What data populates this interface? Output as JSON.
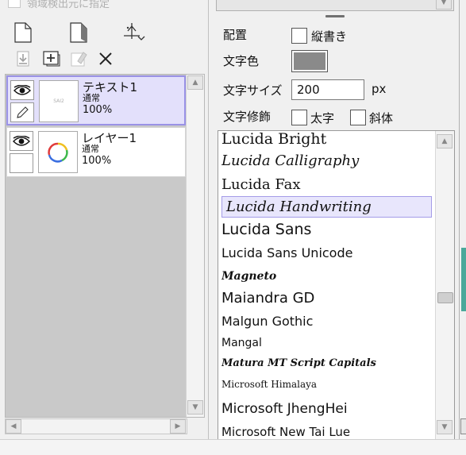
{
  "top_left": {
    "checkbox_label": "領域検出元に指定"
  },
  "layer_tools": {
    "row1": [
      "new-layer-icon",
      "new-folder-icon",
      "text-tool-icon"
    ],
    "row2": [
      "transfer-down-icon",
      "merge-layer-icon",
      "clear-layer-icon",
      "delete-layer-icon"
    ]
  },
  "layers": [
    {
      "name": "テキスト1",
      "mode": "通常",
      "opacity": "100%",
      "thumb_text": "SAI2",
      "selected": true
    },
    {
      "name": "レイヤー1",
      "mode": "通常",
      "opacity": "100%",
      "selected": false
    }
  ],
  "text_props": {
    "placement_label": "配置",
    "vertical_label": "縦書き",
    "color_label": "文字色",
    "color_value": "#8a8a8a",
    "size_label": "文字サイズ",
    "size_value": "200",
    "size_unit": "px",
    "decoration_label": "文字修飾",
    "bold_label": "太字",
    "italic_label": "斜体"
  },
  "fonts": {
    "selected": "Lucida Handwriting",
    "items": [
      "Lucida Bright",
      "Lucida Calligraphy",
      "Lucida Fax",
      "Lucida Handwriting",
      "Lucida Sans",
      "Lucida Sans Unicode",
      "Magneto",
      "Maiandra GD",
      "Malgun Gothic",
      "Mangal",
      "Matura MT Script Capitals",
      "Microsoft Himalaya",
      "Microsoft JhengHei",
      "Microsoft New Tai Lue"
    ]
  }
}
